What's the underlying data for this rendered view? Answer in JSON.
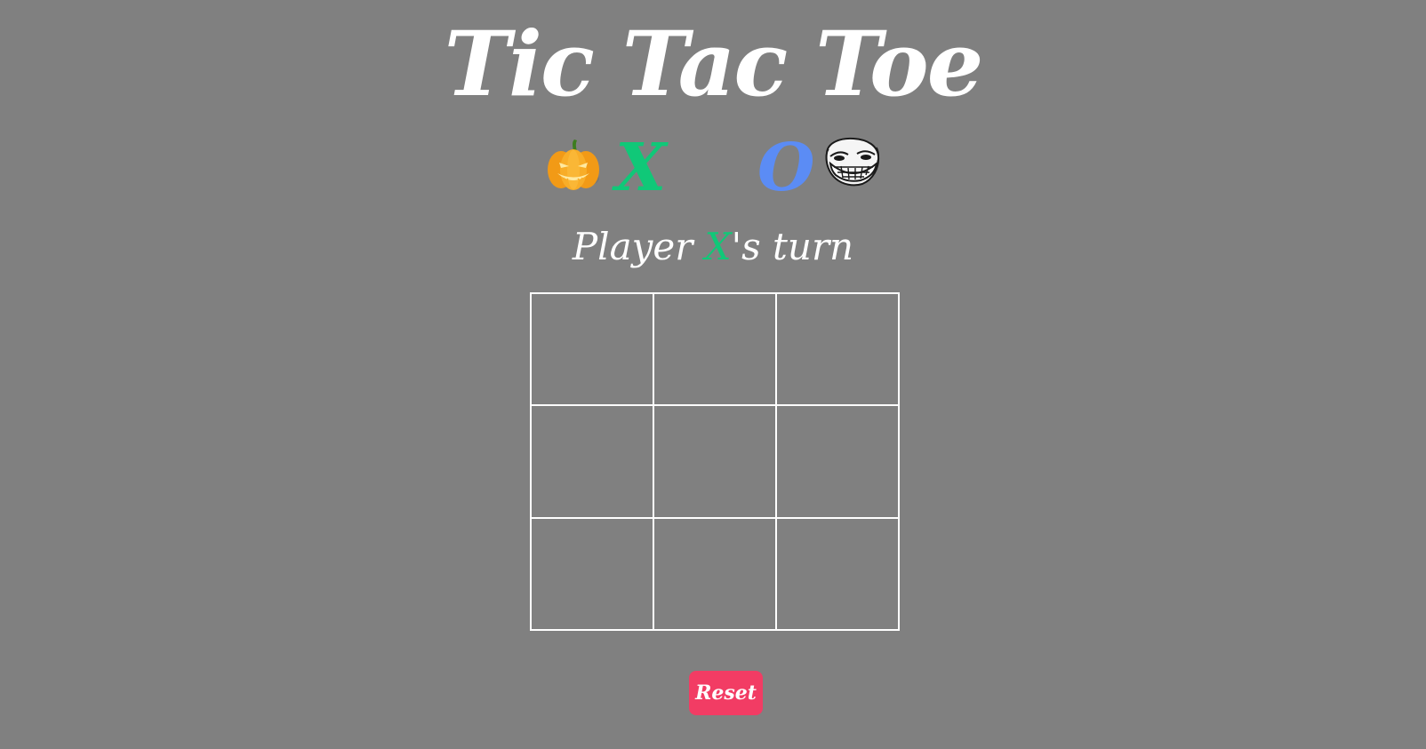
{
  "title": "Tic Tac Toe",
  "players": {
    "x": {
      "mark": "X",
      "color": "#10c878",
      "avatar_icon": "pumpkin-icon"
    },
    "o": {
      "mark": "O",
      "color": "#5b8cf5",
      "avatar_icon": "troll-face-icon"
    }
  },
  "status": {
    "prefix": "Player ",
    "current_player": "X",
    "suffix": "'s turn"
  },
  "board": {
    "cells": [
      "",
      "",
      "",
      "",
      "",
      "",
      "",
      "",
      ""
    ]
  },
  "reset": {
    "label": "Reset",
    "color": "#f23c64"
  },
  "colors": {
    "background": "#808080",
    "text": "#ffffff",
    "grid_lines": "#ffffff"
  }
}
